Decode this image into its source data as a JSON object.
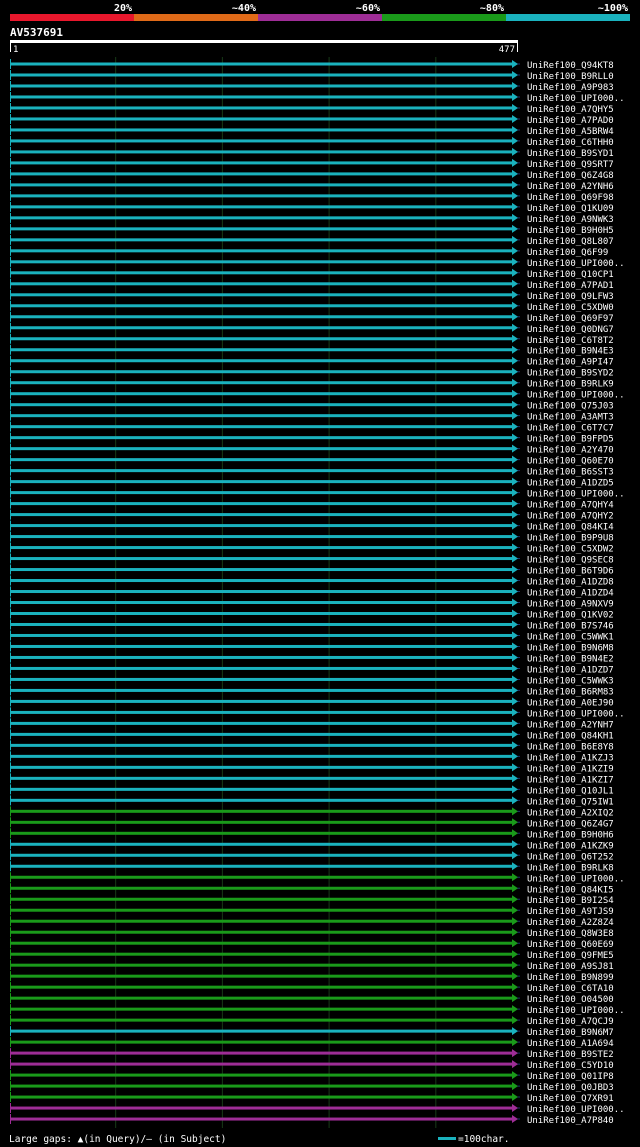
{
  "chart_data": {
    "type": "alignment-bars",
    "title": "AV537691",
    "query_length": 477,
    "ruler": {
      "start": "1",
      "end": "477"
    },
    "identity_legend": [
      {
        "label": "20%",
        "color": "#e8172c"
      },
      {
        "label": "~40%",
        "color": "#e06a18"
      },
      {
        "label": "~60%",
        "color": "#9e2d96"
      },
      {
        "label": "~80%",
        "color": "#1a9a1a"
      },
      {
        "label": "~100%",
        "color": "#1ab2be"
      }
    ],
    "gap_legend": "Large gaps: ▲(in Query)/— (in Subject)",
    "scale_legend": "=100char.",
    "hits": [
      {
        "name": "UniRef100_Q94KT8",
        "start": 1,
        "end": 477,
        "color": "#1ab2be"
      },
      {
        "name": "UniRef100_B9RLL0",
        "start": 1,
        "end": 477,
        "color": "#1ab2be"
      },
      {
        "name": "UniRef100_A9P983",
        "start": 1,
        "end": 477,
        "color": "#1ab2be"
      },
      {
        "name": "UniRef100_UPI000..",
        "start": 1,
        "end": 477,
        "color": "#1ab2be"
      },
      {
        "name": "UniRef100_A7QHY5",
        "start": 1,
        "end": 477,
        "color": "#1ab2be"
      },
      {
        "name": "UniRef100_A7PAD0",
        "start": 1,
        "end": 477,
        "color": "#1ab2be"
      },
      {
        "name": "UniRef100_A5BRW4",
        "start": 1,
        "end": 477,
        "color": "#1ab2be"
      },
      {
        "name": "UniRef100_C6THH0",
        "start": 1,
        "end": 477,
        "color": "#1ab2be"
      },
      {
        "name": "UniRef100_B9SYD1",
        "start": 1,
        "end": 477,
        "color": "#1ab2be"
      },
      {
        "name": "UniRef100_Q9SRT7",
        "start": 1,
        "end": 477,
        "color": "#1ab2be"
      },
      {
        "name": "UniRef100_Q6Z4G8",
        "start": 1,
        "end": 477,
        "color": "#1ab2be"
      },
      {
        "name": "UniRef100_A2YNH6",
        "start": 1,
        "end": 477,
        "color": "#1ab2be"
      },
      {
        "name": "UniRef100_Q69F98",
        "start": 1,
        "end": 477,
        "color": "#1ab2be"
      },
      {
        "name": "UniRef100_Q1KU09",
        "start": 1,
        "end": 477,
        "color": "#1ab2be"
      },
      {
        "name": "UniRef100_A9NWK3",
        "start": 1,
        "end": 477,
        "color": "#1ab2be"
      },
      {
        "name": "UniRef100_B9H0H5",
        "start": 1,
        "end": 477,
        "color": "#1ab2be"
      },
      {
        "name": "UniRef100_Q8L807",
        "start": 1,
        "end": 477,
        "color": "#1ab2be"
      },
      {
        "name": "UniRef100_Q6F99",
        "start": 1,
        "end": 477,
        "color": "#1ab2be"
      },
      {
        "name": "UniRef100_UPI000..",
        "start": 1,
        "end": 477,
        "color": "#1ab2be"
      },
      {
        "name": "UniRef100_Q10CP1",
        "start": 1,
        "end": 477,
        "color": "#1ab2be"
      },
      {
        "name": "UniRef100_A7PAD1",
        "start": 1,
        "end": 477,
        "color": "#1ab2be"
      },
      {
        "name": "UniRef100_Q9LFW3",
        "start": 1,
        "end": 477,
        "color": "#1ab2be"
      },
      {
        "name": "UniRef100_C5XDW0",
        "start": 1,
        "end": 477,
        "color": "#1ab2be"
      },
      {
        "name": "UniRef100_Q69F97",
        "start": 1,
        "end": 477,
        "color": "#1ab2be"
      },
      {
        "name": "UniRef100_Q0DNG7",
        "start": 1,
        "end": 477,
        "color": "#1ab2be"
      },
      {
        "name": "UniRef100_C6T8T2",
        "start": 1,
        "end": 477,
        "color": "#1ab2be"
      },
      {
        "name": "UniRef100_B9N4E3",
        "start": 1,
        "end": 477,
        "color": "#1ab2be"
      },
      {
        "name": "UniRef100_A9PI47",
        "start": 1,
        "end": 477,
        "color": "#1ab2be"
      },
      {
        "name": "UniRef100_B9SYD2",
        "start": 1,
        "end": 477,
        "color": "#1ab2be"
      },
      {
        "name": "UniRef100_B9RLK9",
        "start": 1,
        "end": 477,
        "color": "#1ab2be"
      },
      {
        "name": "UniRef100_UPI000..",
        "start": 1,
        "end": 477,
        "color": "#1ab2be"
      },
      {
        "name": "UniRef100_Q75J03",
        "start": 1,
        "end": 477,
        "color": "#1ab2be"
      },
      {
        "name": "UniRef100_A3AMT3",
        "start": 1,
        "end": 477,
        "color": "#1ab2be"
      },
      {
        "name": "UniRef100_C6T7C7",
        "start": 1,
        "end": 477,
        "color": "#1ab2be"
      },
      {
        "name": "UniRef100_B9FPD5",
        "start": 1,
        "end": 477,
        "color": "#1ab2be"
      },
      {
        "name": "UniRef100_A2Y470",
        "start": 1,
        "end": 477,
        "color": "#1ab2be"
      },
      {
        "name": "UniRef100_Q60E70",
        "start": 1,
        "end": 477,
        "color": "#1ab2be"
      },
      {
        "name": "UniRef100_B6SST3",
        "start": 1,
        "end": 477,
        "color": "#1ab2be"
      },
      {
        "name": "UniRef100_A1DZD5",
        "start": 1,
        "end": 477,
        "color": "#1ab2be"
      },
      {
        "name": "UniRef100_UPI000..",
        "start": 1,
        "end": 477,
        "color": "#1ab2be"
      },
      {
        "name": "UniRef100_A7QHY4",
        "start": 1,
        "end": 477,
        "color": "#1ab2be"
      },
      {
        "name": "UniRef100_A7QHY2",
        "start": 1,
        "end": 477,
        "color": "#1ab2be"
      },
      {
        "name": "UniRef100_Q84KI4",
        "start": 1,
        "end": 477,
        "color": "#1ab2be"
      },
      {
        "name": "UniRef100_B9P9U8",
        "start": 1,
        "end": 477,
        "color": "#1ab2be"
      },
      {
        "name": "UniRef100_C5XDW2",
        "start": 1,
        "end": 477,
        "color": "#1ab2be"
      },
      {
        "name": "UniRef100_Q9SEC8",
        "start": 1,
        "end": 477,
        "color": "#1ab2be"
      },
      {
        "name": "UniRef100_B6T9D6",
        "start": 1,
        "end": 477,
        "color": "#1ab2be"
      },
      {
        "name": "UniRef100_A1DZD8",
        "start": 1,
        "end": 477,
        "color": "#1ab2be"
      },
      {
        "name": "UniRef100_A1DZD4",
        "start": 1,
        "end": 477,
        "color": "#1ab2be"
      },
      {
        "name": "UniRef100_A9NXV9",
        "start": 1,
        "end": 477,
        "color": "#1ab2be"
      },
      {
        "name": "UniRef100_Q1KV02",
        "start": 1,
        "end": 477,
        "color": "#1ab2be"
      },
      {
        "name": "UniRef100_B7S746",
        "start": 1,
        "end": 477,
        "color": "#1ab2be"
      },
      {
        "name": "UniRef100_C5WWK1",
        "start": 1,
        "end": 477,
        "color": "#1ab2be"
      },
      {
        "name": "UniRef100_B9N6M8",
        "start": 1,
        "end": 477,
        "color": "#1ab2be"
      },
      {
        "name": "UniRef100_B9N4E2",
        "start": 1,
        "end": 477,
        "color": "#1ab2be"
      },
      {
        "name": "UniRef100_A1DZD7",
        "start": 1,
        "end": 477,
        "color": "#1ab2be"
      },
      {
        "name": "UniRef100_C5WWK3",
        "start": 1,
        "end": 477,
        "color": "#1ab2be"
      },
      {
        "name": "UniRef100_B6RM83",
        "start": 1,
        "end": 477,
        "color": "#1ab2be"
      },
      {
        "name": "UniRef100_A0EJ90",
        "start": 1,
        "end": 477,
        "color": "#1ab2be"
      },
      {
        "name": "UniRef100_UPI000..",
        "start": 1,
        "end": 477,
        "color": "#1ab2be"
      },
      {
        "name": "UniRef100_A2YNH7",
        "start": 1,
        "end": 477,
        "color": "#1ab2be"
      },
      {
        "name": "UniRef100_Q84KH1",
        "start": 1,
        "end": 477,
        "color": "#1ab2be"
      },
      {
        "name": "UniRef100_B6E8Y8",
        "start": 1,
        "end": 477,
        "color": "#1ab2be"
      },
      {
        "name": "UniRef100_A1KZJ3",
        "start": 1,
        "end": 477,
        "color": "#1ab2be"
      },
      {
        "name": "UniRef100_A1KZI9",
        "start": 1,
        "end": 477,
        "color": "#1ab2be"
      },
      {
        "name": "UniRef100_A1KZI7",
        "start": 1,
        "end": 477,
        "color": "#1ab2be"
      },
      {
        "name": "UniRef100_Q10JL1",
        "start": 1,
        "end": 477,
        "color": "#1ab2be"
      },
      {
        "name": "UniRef100_Q75IW1",
        "start": 1,
        "end": 477,
        "color": "#1ab2be"
      },
      {
        "name": "UniRef100_A2XIQ2",
        "start": 1,
        "end": 477,
        "color": "#1a9a1a"
      },
      {
        "name": "UniRef100_Q6Z4G7",
        "start": 1,
        "end": 477,
        "color": "#1a9a1a"
      },
      {
        "name": "UniRef100_B9H0H6",
        "start": 1,
        "end": 477,
        "color": "#1a9a1a"
      },
      {
        "name": "UniRef100_A1KZK9",
        "start": 1,
        "end": 477,
        "color": "#1ab2be"
      },
      {
        "name": "UniRef100_Q6T252",
        "start": 1,
        "end": 477,
        "color": "#1ab2be"
      },
      {
        "name": "UniRef100_B9RLK8",
        "start": 1,
        "end": 477,
        "color": "#1ab2be"
      },
      {
        "name": "UniRef100_UPI000..",
        "start": 1,
        "end": 477,
        "color": "#1a9a1a"
      },
      {
        "name": "UniRef100_Q84KI5",
        "start": 1,
        "end": 477,
        "color": "#1a9a1a"
      },
      {
        "name": "UniRef100_B9I2S4",
        "start": 1,
        "end": 477,
        "color": "#1a9a1a"
      },
      {
        "name": "UniRef100_A9TJS9",
        "start": 1,
        "end": 477,
        "color": "#1a9a1a"
      },
      {
        "name": "UniRef100_A2Z8Z4",
        "start": 1,
        "end": 477,
        "color": "#1a9a1a"
      },
      {
        "name": "UniRef100_Q8W3E8",
        "start": 1,
        "end": 477,
        "color": "#1a9a1a"
      },
      {
        "name": "UniRef100_Q60E69",
        "start": 1,
        "end": 477,
        "color": "#1a9a1a"
      },
      {
        "name": "UniRef100_Q9FME5",
        "start": 1,
        "end": 477,
        "color": "#1a9a1a"
      },
      {
        "name": "UniRef100_A9SJ81",
        "start": 1,
        "end": 477,
        "color": "#1a9a1a"
      },
      {
        "name": "UniRef100_B9N899",
        "start": 1,
        "end": 477,
        "color": "#1a9a1a"
      },
      {
        "name": "UniRef100_C6TA10",
        "start": 1,
        "end": 477,
        "color": "#1a9a1a"
      },
      {
        "name": "UniRef100_O04500",
        "start": 1,
        "end": 477,
        "color": "#1a9a1a"
      },
      {
        "name": "UniRef100_UPI000..",
        "start": 1,
        "end": 477,
        "color": "#1a9a1a"
      },
      {
        "name": "UniRef100_A7QCJ9",
        "start": 1,
        "end": 477,
        "color": "#1a9a1a"
      },
      {
        "name": "UniRef100_B9N6M7",
        "start": 1,
        "end": 477,
        "color": "#1ab2be"
      },
      {
        "name": "UniRef100_A1A694",
        "start": 1,
        "end": 477,
        "color": "#1a9a1a"
      },
      {
        "name": "UniRef100_B9STE2",
        "start": 1,
        "end": 477,
        "color": "#9e2d96"
      },
      {
        "name": "UniRef100_C5YD10",
        "start": 1,
        "end": 477,
        "color": "#9e2d96"
      },
      {
        "name": "UniRef100_Q01IP8",
        "start": 1,
        "end": 477,
        "color": "#1a9a1a"
      },
      {
        "name": "UniRef100_Q0JBD3",
        "start": 1,
        "end": 477,
        "color": "#1a9a1a"
      },
      {
        "name": "UniRef100_Q7XR91",
        "start": 1,
        "end": 477,
        "color": "#1a9a1a"
      },
      {
        "name": "UniRef100_UPI000..",
        "start": 1,
        "end": 477,
        "color": "#9e2d96"
      },
      {
        "name": "UniRef100_A7P840",
        "start": 1,
        "end": 477,
        "color": "#9e2d96"
      }
    ]
  }
}
